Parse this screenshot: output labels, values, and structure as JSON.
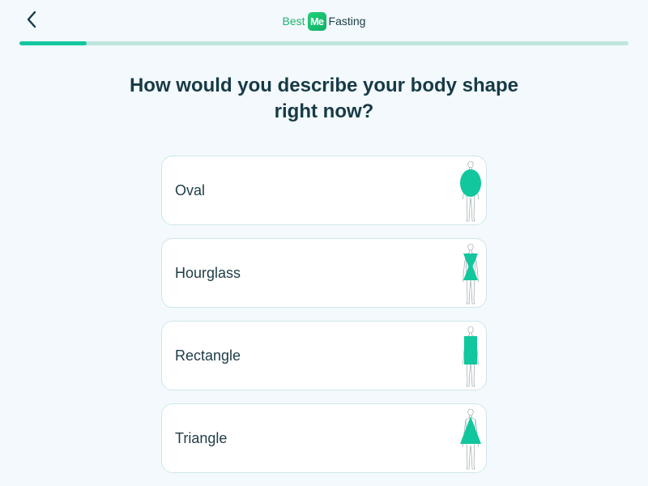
{
  "header": {
    "logo": {
      "best": "Best",
      "badge": "Me",
      "fasting": "Fasting"
    },
    "icons": {
      "back": "chevron-left-icon"
    }
  },
  "progress": {
    "value": 0.11
  },
  "question": "How would you describe your body shape right now?",
  "options": [
    {
      "label": "Oval",
      "shape": "oval"
    },
    {
      "label": "Hourglass",
      "shape": "hourglass"
    },
    {
      "label": "Rectangle",
      "shape": "rectangle"
    },
    {
      "label": "Triangle",
      "shape": "triangle"
    }
  ],
  "colors": {
    "accent": "#15c7a0",
    "track": "#bfe6de",
    "shape_fill": "#12c79d",
    "text": "#163a46",
    "logo_green": "#1db36f",
    "background": "#f3f9fc"
  }
}
